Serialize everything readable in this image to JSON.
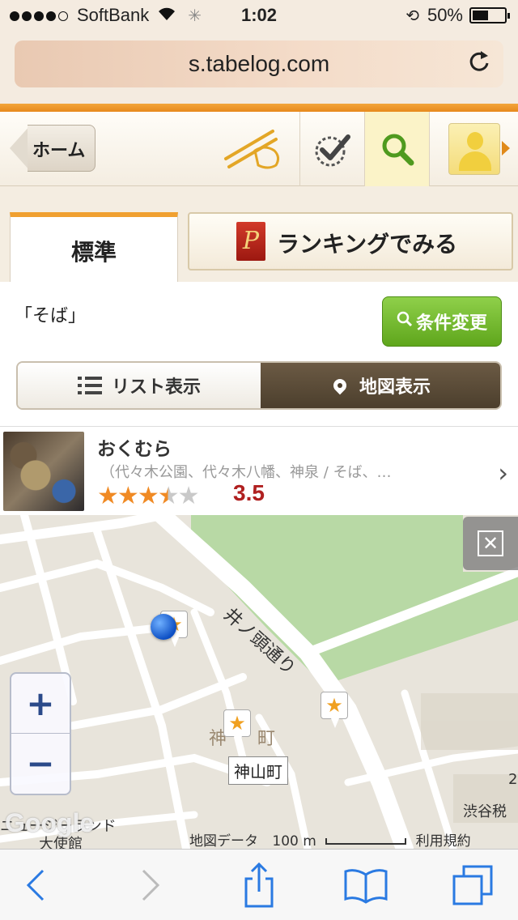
{
  "status_bar": {
    "carrier": "SoftBank",
    "time": "1:02",
    "battery": "50%",
    "battery_level": 0.5
  },
  "browser": {
    "url": "s.tabelog.com"
  },
  "header": {
    "home_label": "ホーム"
  },
  "tabs": {
    "standard": "標準",
    "ranking": "ランキングでみる",
    "ranking_logo": "P"
  },
  "search": {
    "query": "「そば」",
    "change_conditions": "条件変更"
  },
  "view_toggle": {
    "list": "リスト表示",
    "map": "地図表示",
    "selected": "map"
  },
  "restaurant": {
    "name": "おくむら",
    "subtitle": "（代々木公園、代々木八幡、神泉 / そば、…",
    "rating": 3.5,
    "rating_label": "3.5"
  },
  "map": {
    "road_label": "井ノ頭通り",
    "district_partial": "神",
    "district_partial2": "町",
    "station": "神山町",
    "embassy_1": "ニュージーランド",
    "embassy_2": "大使館",
    "tax_office": "渋谷税",
    "side_number": "2",
    "watermark": "Google",
    "map_data_label": "地図データ",
    "scale_label": "100 m",
    "terms_label": "利用規約",
    "colors": {
      "park": "#b8d9a5",
      "land": "#e8e4db",
      "road": "#ffffff"
    }
  },
  "icons": {
    "status": [
      "wifi-icon",
      "activity-spinner-icon",
      "rotation-lock-icon",
      "battery-icon"
    ],
    "header": [
      "chopsticks-icon",
      "checkmark-icon",
      "search-icon",
      "user-icon"
    ],
    "toolbar": [
      "back-icon",
      "forward-icon",
      "share-icon",
      "bookmarks-icon",
      "tabs-icon"
    ]
  }
}
